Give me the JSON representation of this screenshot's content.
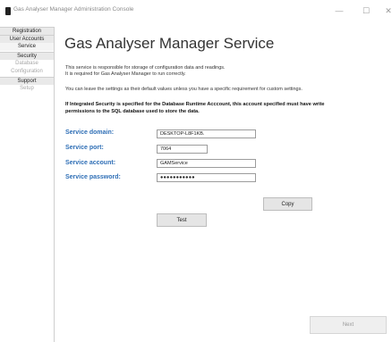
{
  "window": {
    "title": "Gas Analyser Manager Administration Console",
    "minimize": "—",
    "maximize": "☐",
    "close": "✕"
  },
  "sidebar": {
    "items": [
      {
        "label": "Registration",
        "kind": "group",
        "state": "normal"
      },
      {
        "label": "User Accounts",
        "kind": "group",
        "state": "normal"
      },
      {
        "label": "Service",
        "kind": "sub",
        "state": "selected"
      },
      {
        "label": "Security",
        "kind": "group",
        "state": "normal"
      },
      {
        "label": "Database",
        "kind": "sub",
        "state": "disabled"
      },
      {
        "label": "Configuration",
        "kind": "sub",
        "state": "disabled"
      },
      {
        "label": "Support",
        "kind": "group",
        "state": "normal"
      },
      {
        "label": "Setup",
        "kind": "sub",
        "state": "disabled"
      }
    ]
  },
  "main": {
    "heading": "Gas Analyser Manager Service",
    "para1_line1": "This service is responsible for storage of configuration data and readings.",
    "para1_line2": "It is required for Gas Analyser Manager to run correctly.",
    "para2": "You can leave the settings as their default values unless you have a specific requirement for custom settings.",
    "warning_line1": "If Integrated Security is specified for the Database Runtime Acccount, this account specified must have write",
    "warning_line2": "permissions to the SQL database used to store the data.",
    "fields": {
      "domain_label": "Service domain:",
      "domain_value": "DESKTOP-L8F1KB.",
      "port_label": "Service port:",
      "port_value": "7064",
      "account_label": "Service account:",
      "account_value": "GAMService",
      "password_label": "Service password:",
      "password_value": "●●●●●●●●●●●"
    },
    "copy_button": "Copy",
    "test_button": "Test",
    "next_button": "Next"
  },
  "colors": {
    "label_blue": "#2f6fb6"
  }
}
